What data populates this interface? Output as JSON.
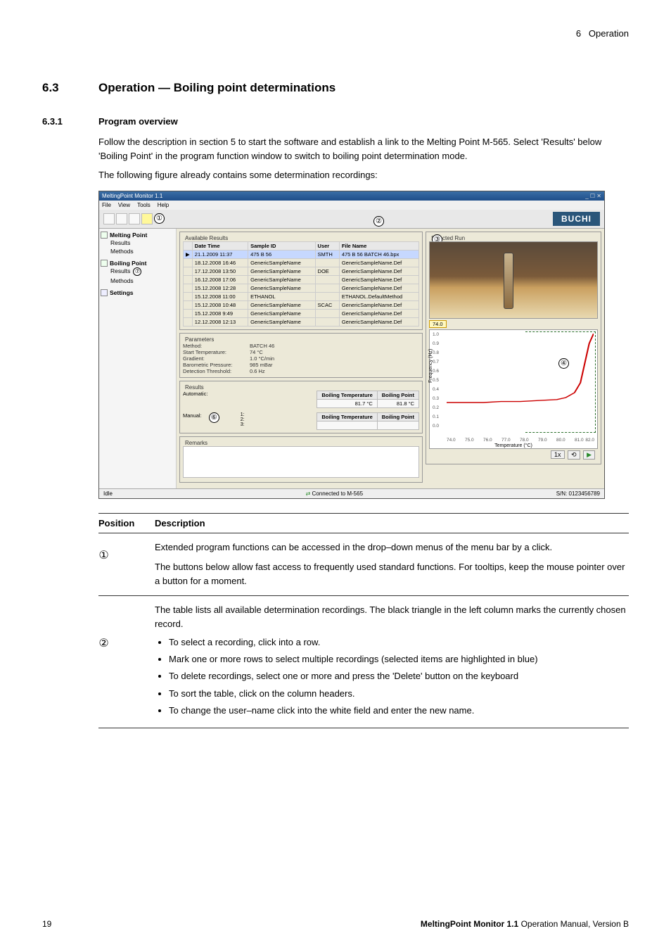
{
  "page_header": {
    "chapter": "6",
    "chapter_title": "Operation"
  },
  "section": {
    "num": "6.3",
    "title": "Operation — Boiling point determinations"
  },
  "subsection": {
    "num": "6.3.1",
    "title": "Program overview"
  },
  "para1": "Follow the description in section 5 to start the software and establish a link to the Melting Point M-565. Select 'Results' below 'Boiling Point' in the program function window to switch to boiling point determination mode.",
  "para2": "The following figure already contains some determination recordings:",
  "app": {
    "title": "MeltingPoint Monitor 1.1",
    "menus": [
      "File",
      "View",
      "Tools",
      "Help"
    ],
    "brand": "BUCHI",
    "sidebar": {
      "groups": [
        {
          "title": "Melting Point",
          "items": [
            "Results",
            "Methods"
          ]
        },
        {
          "title": "Boiling Point",
          "items": [
            "Results",
            "Methods"
          ]
        },
        {
          "title": "Settings",
          "items": []
        }
      ]
    },
    "available": {
      "legend": "Available Results",
      "columns": [
        "Date Time",
        "Sample ID",
        "User",
        "File Name"
      ],
      "rows": [
        {
          "dt": "21.1.2009 11:37",
          "sid": "475 B 56",
          "user": "SMTH",
          "fn": "475 B 56 BATCH 46.bpx",
          "selected": true
        },
        {
          "dt": "18.12.2008 16:46",
          "sid": "GenericSampleName",
          "user": "",
          "fn": "GenericSampleName.Def"
        },
        {
          "dt": "17.12.2008 13:50",
          "sid": "GenericSampleName",
          "user": "DOE",
          "fn": "GenericSampleName.Def"
        },
        {
          "dt": "16.12.2008 17:06",
          "sid": "GenericSampleName",
          "user": "",
          "fn": "GenericSampleName.Def"
        },
        {
          "dt": "15.12.2008 12:28",
          "sid": "GenericSampleName",
          "user": "",
          "fn": "GenericSampleName.Def"
        },
        {
          "dt": "15.12.2008 11:00",
          "sid": "ETHANOL",
          "user": "",
          "fn": "ETHANOL.DefaultMethod"
        },
        {
          "dt": "15.12.2008 10:48",
          "sid": "GenericSampleName",
          "user": "SCAC",
          "fn": "GenericSampleName.Def"
        },
        {
          "dt": "15.12.2008 9:49",
          "sid": "GenericSampleName",
          "user": "",
          "fn": "GenericSampleName.Def"
        },
        {
          "dt": "12.12.2008 12:13",
          "sid": "GenericSampleName",
          "user": "",
          "fn": "GenericSampleName.Def"
        }
      ]
    },
    "parameters": {
      "legend": "Parameters",
      "rows": [
        {
          "lbl": "Method:",
          "val": "BATCH 46"
        },
        {
          "lbl": "Start Temperature:",
          "val": "74 °C"
        },
        {
          "lbl": "Gradient:",
          "val": "1.0 °C/min"
        },
        {
          "lbl": "Barometric Pressure:",
          "val": "985 mBar"
        },
        {
          "lbl": "Detection Threshold:",
          "val": "0.6 Hz"
        }
      ]
    },
    "results": {
      "legend": "Results",
      "auto_label": "Automatic:",
      "auto_headers": [
        "Boiling Temperature",
        "Boiling Point"
      ],
      "auto_values": [
        "81.7 °C",
        "81.8 °C"
      ],
      "manual_label": "Manual:",
      "manual_headers": [
        "Boiling Temperature",
        "Boiling Point"
      ],
      "manual_rows": [
        "1:",
        "2:",
        "3:"
      ]
    },
    "remarks": {
      "legend": "Remarks"
    },
    "selected_run": {
      "legend": "Selected Run",
      "marker_value": "74.0",
      "ylabel": "Frequency (Hz)",
      "xlabel": "Temperature (°C)",
      "yticks": [
        "1.0",
        "0.9",
        "0.8",
        "0.7",
        "0.6",
        "0.5",
        "0.4",
        "0.3",
        "0.2",
        "0.1",
        "0.0"
      ],
      "xticks": [
        "74.0",
        "75.0",
        "76.0",
        "77.0",
        "78.0",
        "79.0",
        "80.0",
        "81.0",
        "82.0"
      ],
      "media": {
        "speed": "1x"
      }
    },
    "status": {
      "left": "Idle",
      "mid": "Connected to M-565",
      "right": "S/N: 0123456789"
    }
  },
  "chart_data": {
    "type": "line",
    "title": "Selected Run",
    "xlabel": "Temperature (°C)",
    "ylabel": "Frequency (Hz)",
    "xlim": [
      74.0,
      82.0
    ],
    "ylim": [
      0.0,
      1.0
    ],
    "series": [
      {
        "name": "frequency",
        "x": [
          74.0,
          75.0,
          76.0,
          77.0,
          78.0,
          79.0,
          80.0,
          80.5,
          81.0,
          81.3,
          81.6,
          81.8,
          82.0
        ],
        "y": [
          0.3,
          0.3,
          0.3,
          0.31,
          0.31,
          0.32,
          0.33,
          0.35,
          0.4,
          0.5,
          0.7,
          0.9,
          1.0
        ],
        "color": "#cc0000"
      }
    ]
  },
  "callouts": {
    "c1": "①",
    "c2": "②",
    "c3": "③",
    "c4": "④",
    "c6": "⑥",
    "c7": "⑦"
  },
  "desc": {
    "header": {
      "pos": "Position",
      "desc": "Description"
    },
    "row1": {
      "mark": "①",
      "p1": "Extended program functions can be accessed in the drop–down menus of the menu bar by a click.",
      "p2": "The buttons below allow fast access to frequently used standard functions. For tooltips, keep the mouse pointer over a button for a moment."
    },
    "row2": {
      "mark": "②",
      "intro": "The table lists all available determination recordings. The black triangle in the left column marks the currently chosen record.",
      "bullets": [
        "To select a recording, click into a row.",
        "Mark one or more rows to select multiple recordings (selected items are highlighted in blue)",
        "To delete recordings, select one or more and press the 'Delete' button on the keyboard",
        "To sort the table, click on the column headers.",
        "To change the user–name click into the white field and enter the new name."
      ]
    }
  },
  "footer": {
    "page": "19",
    "product": "MeltingPoint Monitor 1.1",
    "rest": " Operation Manual, Version B"
  }
}
